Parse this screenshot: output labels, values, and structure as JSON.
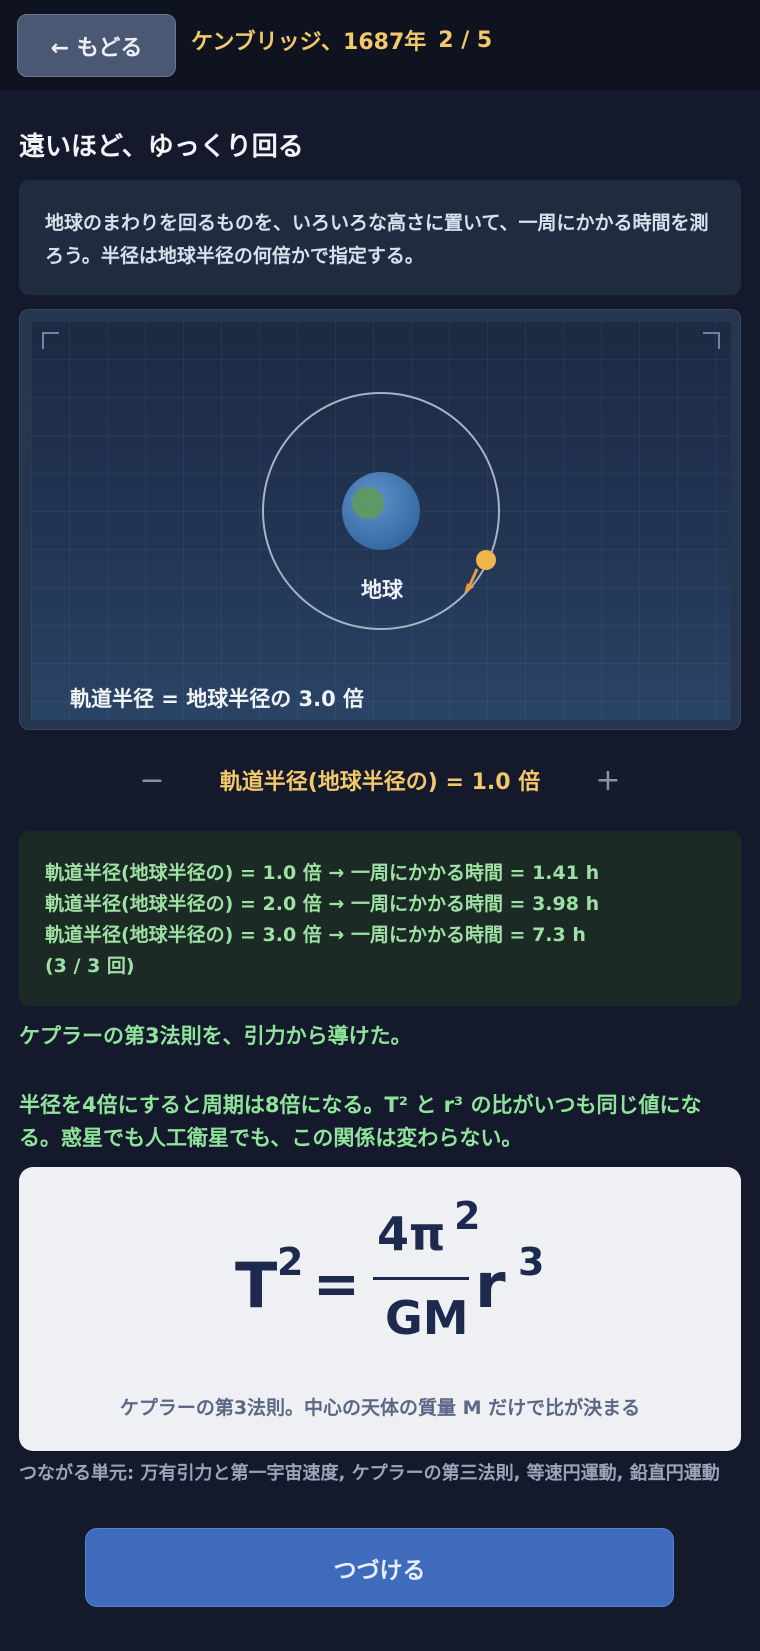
{
  "header": {
    "back_label": "← もどる",
    "place_year": "ケンブリッジ、1687年",
    "progress": "2 / 5"
  },
  "lesson": {
    "title": "遠いほど、ゆっくり回る",
    "intro": "地球のまわりを回るものを、いろいろな高さに置いて、一周にかかる時間を測ろう。半径は地球半径の何倍かで指定する。"
  },
  "simulation": {
    "earth_label": "地球",
    "readout": "軌道半径 = 地球半径の 3.0 倍",
    "orbit_radius_multiple": 3.0
  },
  "stepper": {
    "minus_label": "−",
    "plus_label": "+",
    "value_label": "軌道半径(地球半径の) = 1.0 倍"
  },
  "log": {
    "lines": [
      "軌道半径(地球半径の) = 1.0 倍 → 一周にかかる時間 = 1.41 h",
      "軌道半径(地球半径の) = 2.0 倍 → 一周にかかる時間 = 3.98 h",
      "軌道半径(地球半径の) = 3.0 倍 → 一周にかかる時間 = 7.3 h"
    ],
    "count": "(3 / 3 回)"
  },
  "result": {
    "headline": "ケプラーの第3法則を、引力から導けた。",
    "detail": "半径を4倍にすると周期は8倍になる。T² と r³ の比がいつも同じ値になる。惑星でも人工衛星でも、この関係は変わらない。"
  },
  "formula": {
    "lhs": "T",
    "lhs_exp": "2",
    "eq": "=",
    "numerator": "4π",
    "numerator_exp": "2",
    "denominator": "GM",
    "rhs": "r",
    "rhs_exp": "3",
    "caption": "ケプラーの第3法則。中心の天体の質量 M だけで比が決まる"
  },
  "related": "つながる単元: 万有引力と第一宇宙速度, ケプラーの第三法則, 等速円運動, 鉛直円運動",
  "continue_label": "つづける",
  "colors": {
    "accent_gold": "#f2c86a",
    "success_green": "#8fe39a",
    "button_blue": "#3f6bbd",
    "formula_ink": "#1d2a4d"
  }
}
